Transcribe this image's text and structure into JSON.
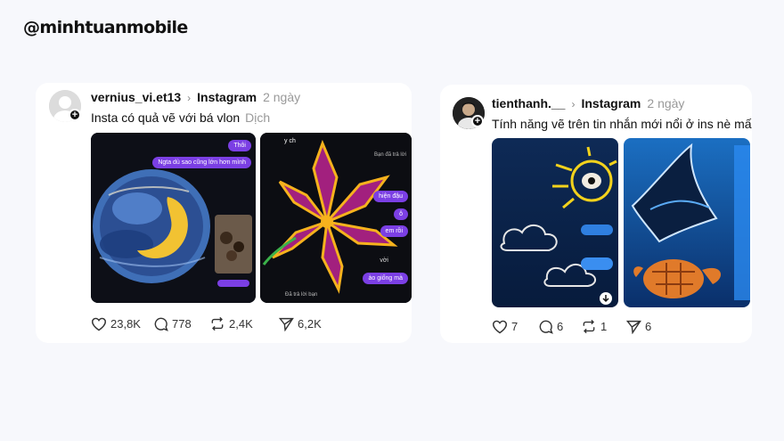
{
  "watermark": "@minhtuanmobile",
  "post1": {
    "username": "vernius_vi.et13",
    "source": "Instagram",
    "time": "2 ngày",
    "caption": "Insta có quả vẽ với bá vlon",
    "translate": "Dịch",
    "chat_bubbles": [
      "Thôi",
      "Ngta dù sao cũng lớn hơn mình"
    ],
    "image2_texts": [
      "y ch",
      "Bạn đã trả lời",
      "hiện đậu",
      "ô",
      "em rồi",
      "vời",
      "ào giống mà",
      "Đã trả lời bạn"
    ],
    "likes": "23,8K",
    "comments": "778",
    "reposts": "2,4K",
    "shares": "6,2K"
  },
  "post2": {
    "username": "tienthanh.__",
    "source": "Instagram",
    "time": "2 ngày",
    "caption": "Tính năng vẽ trên tin nhắn mới nổi ở ins nè mấ",
    "likes": "7",
    "comments": "6",
    "reposts": "1",
    "shares": "6"
  },
  "colors": {
    "accent_purple": "#7b3fe4",
    "bg": "#f7f8fc"
  }
}
